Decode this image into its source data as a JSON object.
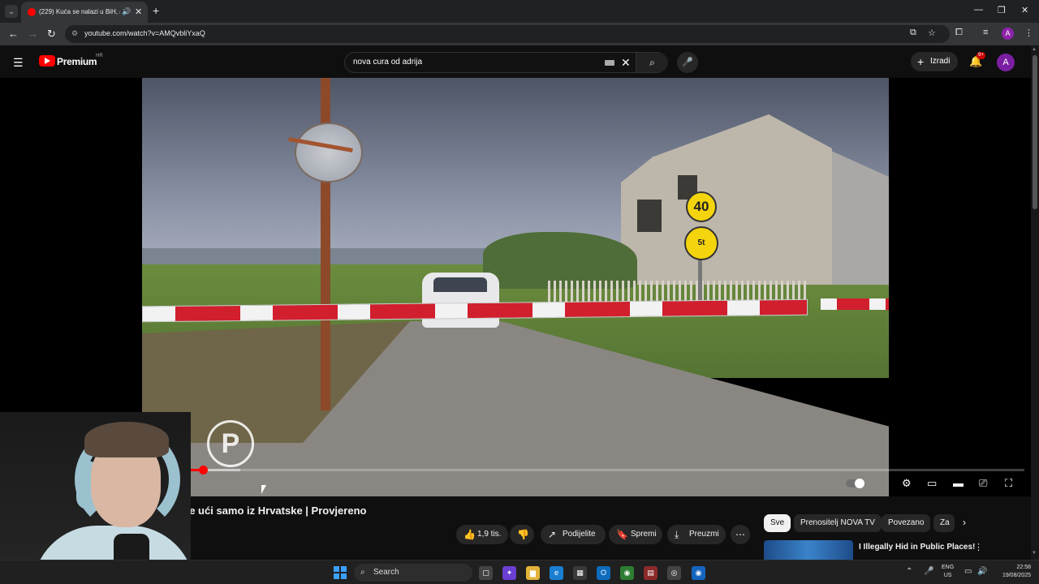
{
  "browser": {
    "tab_title": "(229) Kuća se nalazi u BiH, a",
    "url": "youtube.com/watch?v=AMQvbliYxaQ",
    "profile_initial": "A"
  },
  "header": {
    "brand": "Premium",
    "brand_region": "HR",
    "search_query": "nova cura od adrija",
    "create_label": "Izradi",
    "notif_count": "9+",
    "avatar_initial": "A"
  },
  "player": {
    "played_fraction": 0.193,
    "loaded_fraction": 0.23,
    "watermark": "P"
  },
  "video": {
    "title": "Kuća se nalazi u BiH, a može ući samo iz Hrvatske | Provjereno",
    "likes": "1,9 tis.",
    "share_label": "Podijelite",
    "save_label": "Spremi",
    "download_label": "Preuzmi"
  },
  "chips": {
    "items": [
      "Sve",
      "Prenositelj NOVA TV",
      "Povezano",
      "Za"
    ]
  },
  "recommendation": {
    "title": "I Illegally Hid in Public Places!"
  },
  "taskbar": {
    "search_label": "Search",
    "lang_top": "ENG",
    "lang_bottom": "US",
    "time": "22:58",
    "date": "19/08/2025"
  },
  "colors": {
    "accent_red": "#ff0000",
    "background": "#0f0f0f",
    "chip_bg": "#272727"
  }
}
